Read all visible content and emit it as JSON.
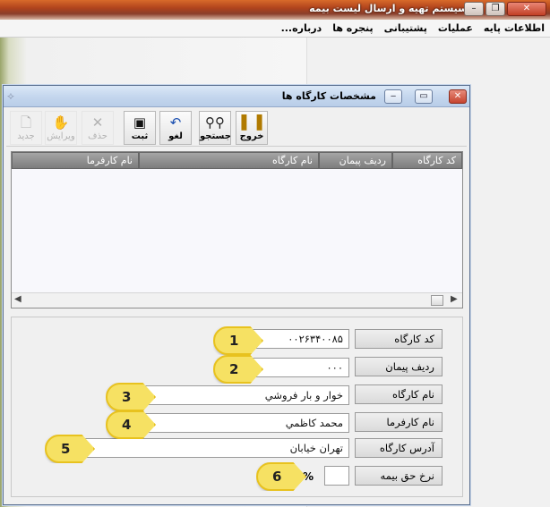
{
  "app": {
    "title": "سیستم تهیه و ارسال لیست بیمه",
    "window_controls": {
      "minimize": "–",
      "restore": "❐",
      "close": "✕"
    },
    "menu": [
      "اطلاعات پایه",
      "عملیات",
      "پشتیبانی",
      "پنجره ها",
      "درباره..."
    ]
  },
  "dialog": {
    "title": "مشخصات کارگاه ها",
    "toolbar": [
      {
        "id": "exit",
        "label": "خروج",
        "icon": "exit-door-icon",
        "glyph": "▌▐",
        "enabled": true
      },
      {
        "id": "search",
        "label": "جستجو",
        "icon": "binoculars-icon",
        "glyph": "⚲⚲",
        "enabled": true
      },
      {
        "id": "cancel",
        "label": "لغو",
        "icon": "undo-icon",
        "glyph": "↶",
        "enabled": true
      },
      {
        "id": "save",
        "label": "ثبت",
        "icon": "floppy-disk-icon",
        "glyph": "▣",
        "enabled": true
      },
      {
        "id": "delete",
        "label": "حذف",
        "icon": "delete-x-icon",
        "glyph": "✕",
        "enabled": false
      },
      {
        "id": "edit",
        "label": "ویرایش",
        "icon": "edit-hands-icon",
        "glyph": "✋",
        "enabled": false
      },
      {
        "id": "new",
        "label": "جدید",
        "icon": "new-document-icon",
        "glyph": "🗋",
        "enabled": false
      }
    ],
    "grid": {
      "columns": [
        "کد کارگاه",
        "ردیف پیمان",
        "نام کارگاه",
        "نام کارفرما"
      ],
      "rows": []
    },
    "form": {
      "fields": [
        {
          "label": "کد کارگاه",
          "value": "۰۰۲۶۳۴۰۰۸۵",
          "badge": "1"
        },
        {
          "label": "ردیف پیمان",
          "value": "۰۰۰",
          "badge": "2"
        },
        {
          "label": "نام کارگاه",
          "value": "خوار و بار فروشي",
          "badge": "3"
        },
        {
          "label": "نام کارفرما",
          "value": "محمد کاظمي",
          "badge": "4"
        },
        {
          "label": "آدرس کارگاه",
          "value": "تهران خيابان",
          "badge": "5"
        },
        {
          "label": "نرخ حق بیمه",
          "value": "",
          "badge": "6",
          "suffix": "%"
        }
      ]
    }
  },
  "colors": {
    "badge_fill": "#f6e163",
    "titlebar_accent": "#b1441d",
    "grid_header": "#8a8a8a"
  }
}
